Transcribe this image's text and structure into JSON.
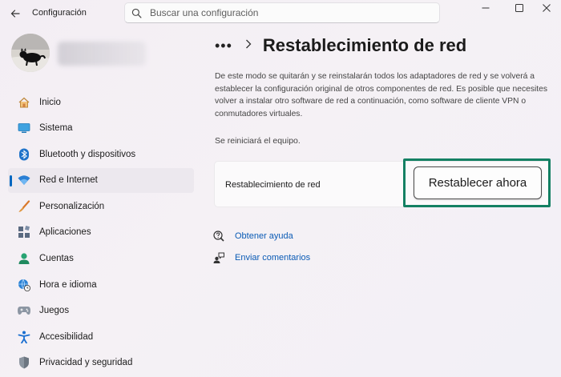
{
  "window": {
    "app_title": "Configuración",
    "search_placeholder": "Buscar una configuración"
  },
  "sidebar": {
    "items": [
      {
        "label": "Inicio",
        "icon": "home-icon"
      },
      {
        "label": "Sistema",
        "icon": "system-icon"
      },
      {
        "label": "Bluetooth y dispositivos",
        "icon": "bluetooth-icon"
      },
      {
        "label": "Red e Internet",
        "icon": "wifi-icon",
        "active": true
      },
      {
        "label": "Personalización",
        "icon": "brush-icon"
      },
      {
        "label": "Aplicaciones",
        "icon": "apps-icon"
      },
      {
        "label": "Cuentas",
        "icon": "person-icon"
      },
      {
        "label": "Hora e idioma",
        "icon": "globe-clock-icon"
      },
      {
        "label": "Juegos",
        "icon": "gamepad-icon"
      },
      {
        "label": "Accesibilidad",
        "icon": "accessibility-icon"
      },
      {
        "label": "Privacidad y seguridad",
        "icon": "shield-icon"
      }
    ]
  },
  "content": {
    "breadcrumb_dots": "•••",
    "title": "Restablecimiento de red",
    "description": "De este modo se quitarán y se reinstalarán todos los adaptadores de red y se volverá a establecer la configuración original de otros componentes de red. Es posible que necesites volver a instalar otro software de red a continuación, como software de cliente VPN o conmutadores virtuales.",
    "restart_note": "Se reiniciará el equipo.",
    "card_label": "Restablecimiento de red",
    "reset_button": "Restablecer ahora",
    "help_link": "Obtener ayuda",
    "feedback_link": "Enviar comentarios"
  },
  "colors": {
    "accent": "#0067c0",
    "highlight_frame": "#148063",
    "link": "#0a5bb5"
  }
}
